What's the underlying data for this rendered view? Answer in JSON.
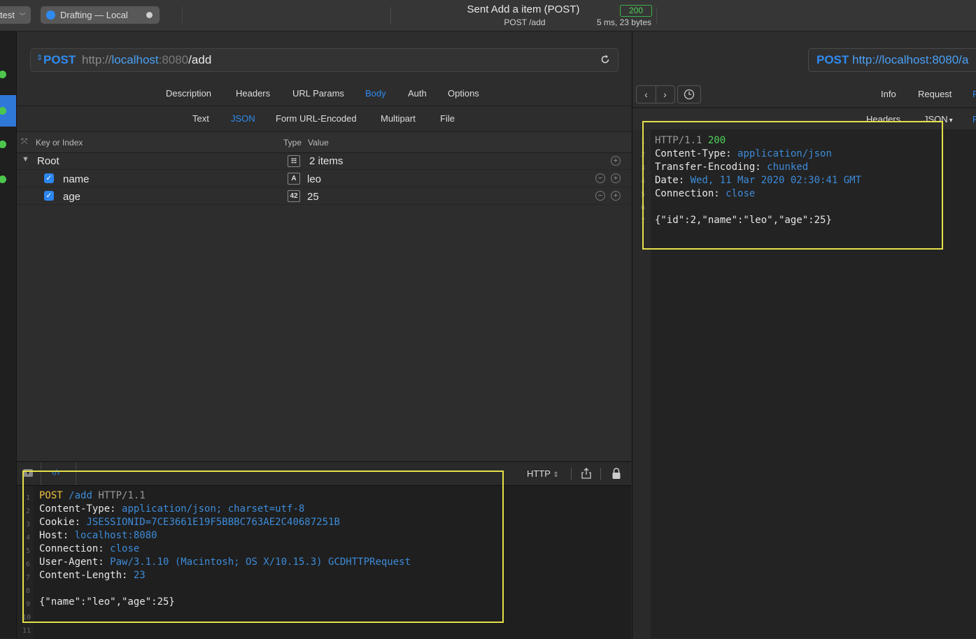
{
  "titlebar": {
    "left_menu": "test",
    "env_label": "Drafting — Local",
    "title": "Sent Add a item (POST)",
    "subtitle": "POST /add",
    "status_code": "200",
    "timing": "5 ms, 23 bytes"
  },
  "request": {
    "method": "POST",
    "url_scheme": "http://",
    "url_host": "localhost",
    "url_port": ":8080",
    "url_path": "/add",
    "tabs": [
      "Description",
      "Headers",
      "URL Params",
      "Body",
      "Auth",
      "Options"
    ],
    "active_tab": "Body",
    "body_tabs": [
      "Text",
      "JSON",
      "Form URL-Encoded",
      "Multipart",
      "File"
    ],
    "active_body_tab": "JSON",
    "table_header": {
      "key": "Key or Index",
      "type": "Type",
      "value": "Value"
    },
    "root": {
      "label": "Root",
      "value": "2 items"
    },
    "rows": [
      {
        "key": "name",
        "type_icon": "A",
        "value": "leo"
      },
      {
        "key": "age",
        "type_icon": "42",
        "value": "25"
      }
    ]
  },
  "code_pane": {
    "format": "HTTP",
    "line_numbers": [
      "1",
      "2",
      "3",
      "4",
      "5",
      "6",
      "7",
      "8",
      "9",
      "10",
      "11"
    ],
    "lines": {
      "l1_method": "POST",
      "l1_path": "/add",
      "l1_proto": "HTTP/1.1",
      "l2_key": "Content-Type",
      "l2_val": "application/json; charset=utf-8",
      "l3_key": "Cookie",
      "l3_val": "JSESSIONID=7CE3661E19F5BBBC763AE2C40687251B",
      "l4_key": "Host",
      "l4_val": "localhost:8080",
      "l5_key": "Connection",
      "l5_val": "close",
      "l6_key": "User-Agent",
      "l6_val": "Paw/3.1.10 (Macintosh; OS X/10.15.3) GCDHTTPRequest",
      "l7_key": "Content-Length",
      "l7_val": "23",
      "l9_body": "{\"name\":\"leo\",\"age\":25}"
    }
  },
  "response": {
    "url_method": "POST",
    "url_text": "http://localhost:8080/a",
    "tabs": [
      "Info",
      "Request"
    ],
    "sub_tabs": [
      "Headers",
      "JSON"
    ],
    "line_numbers": [
      "1",
      "2",
      "3",
      "4",
      "5",
      "6",
      "7"
    ],
    "lines": {
      "l1_proto": "HTTP/1.1",
      "l1_status": "200",
      "l2_key": "Content-Type",
      "l2_val": "application/json",
      "l3_key": "Transfer-Encoding",
      "l3_val": "chunked",
      "l4_key": "Date",
      "l4_val": "Wed, 11 Mar 2020 02:30:41 GMT",
      "l5_key": "Connection",
      "l5_val": "close",
      "l7_body": "{\"id\":2,\"name\":\"leo\",\"age\":25}"
    }
  },
  "colors": {
    "accent": "#2f8bf0",
    "success": "#4fd15a",
    "highlight": "#e5e04a"
  }
}
